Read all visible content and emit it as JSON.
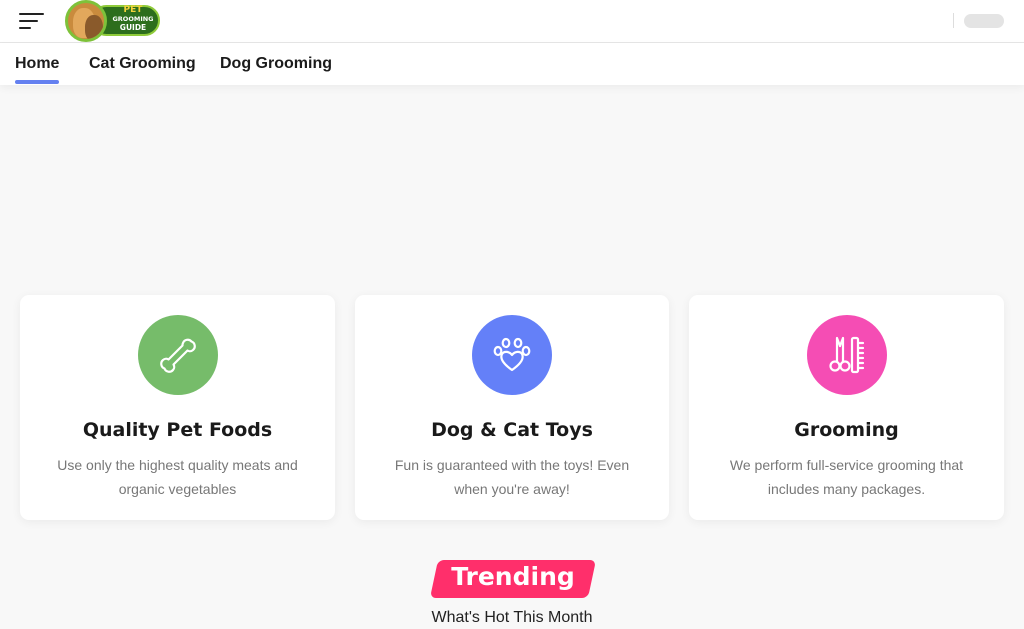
{
  "header": {
    "logo": {
      "line1": "PET",
      "line2": "GROOMING",
      "line3": "GUIDE"
    }
  },
  "nav": {
    "items": [
      {
        "label": "Home",
        "active": true
      },
      {
        "label": "Cat Grooming",
        "active": false
      },
      {
        "label": "Dog Grooming",
        "active": false
      }
    ],
    "accent_color": "#6480f0"
  },
  "features": [
    {
      "title": "Quality Pet Foods",
      "description": "Use only the highest quality meats and organic vegetables",
      "icon": "bone-icon",
      "color": "#76bc6a"
    },
    {
      "title": "Dog & Cat Toys",
      "description": "Fun is guaranteed with the toys! Even when you're away!",
      "icon": "paw-heart-icon",
      "color": "#6480f8"
    },
    {
      "title": "Grooming",
      "description": "We perform full-service grooming that includes many packages.",
      "icon": "scissors-comb-icon",
      "color": "#f54db4"
    }
  ],
  "trending": {
    "title": "Trending",
    "subtitle": "What's Hot This Month",
    "color": "#ff2f6b"
  }
}
